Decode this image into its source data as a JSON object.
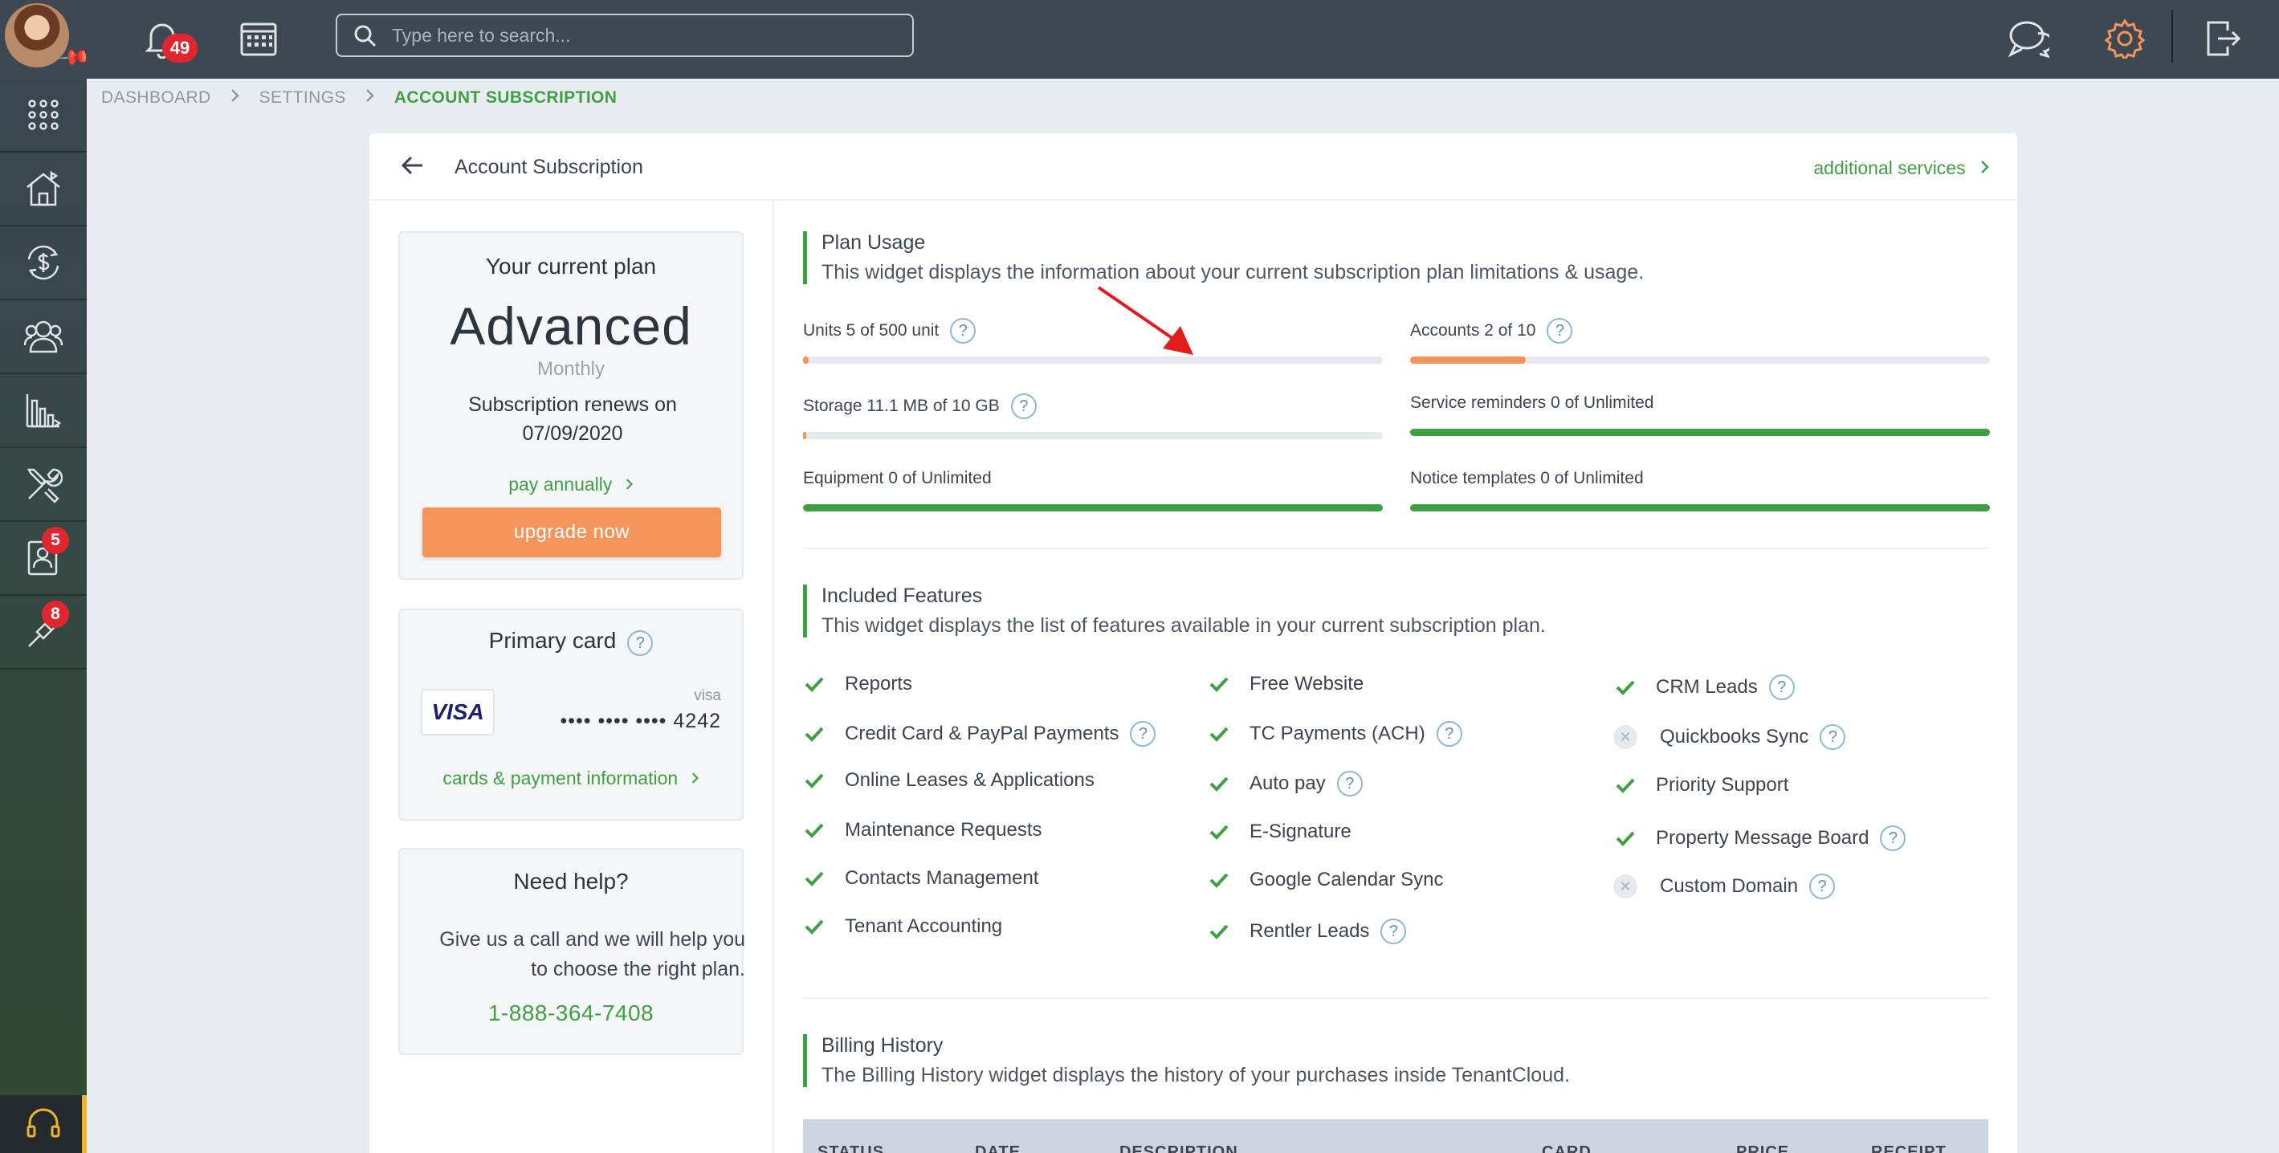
{
  "topbar": {
    "notification_count": "49",
    "search_placeholder": "Type here to search..."
  },
  "sidebar": {
    "items": [
      {
        "icon": "apps-grid-icon"
      },
      {
        "icon": "properties-icon"
      },
      {
        "icon": "accounting-icon"
      },
      {
        "icon": "tenants-icon"
      },
      {
        "icon": "reports-icon"
      },
      {
        "icon": "maintenance-icon"
      },
      {
        "icon": "applications-icon",
        "badge": "5"
      },
      {
        "icon": "tools-icon",
        "badge": "8"
      }
    ]
  },
  "breadcrumb": {
    "items": [
      "DASHBOARD",
      "SETTINGS",
      "ACCOUNT SUBSCRIPTION"
    ]
  },
  "page": {
    "title": "Account Subscription",
    "additional_services": "additional services"
  },
  "plan": {
    "heading": "Your current plan",
    "name": "Advanced",
    "cycle": "Monthly",
    "renew_line1": "Subscription renews on",
    "renew_date": "07/09/2020",
    "pay_annually": "pay annually",
    "upgrade": "upgrade now"
  },
  "primary_card": {
    "heading": "Primary card",
    "brand_logo": "VISA",
    "type": "visa",
    "number": "•••• •••• •••• 4242",
    "link": "cards & payment information"
  },
  "help": {
    "heading": "Need help?",
    "text": "Give us a call and we will help you to choose the right plan.",
    "phone": "1-888-364-7408"
  },
  "plan_usage": {
    "title": "Plan Usage",
    "description": "This widget displays the information about your current subscription plan limitations & usage.",
    "items": [
      {
        "label": "Units 5 of 500 unit",
        "help": true,
        "fill": 0.01,
        "color": "#f4935a"
      },
      {
        "label": "Accounts 2 of 10",
        "help": true,
        "fill": 0.2,
        "color": "#f4935a"
      },
      {
        "label": "Storage 11.1 MB of 10 GB",
        "help": true,
        "fill": 0.001,
        "color": "#f4935a"
      },
      {
        "label": "Service reminders 0 of Unlimited",
        "help": false,
        "fill": 1,
        "color": "#3fa043"
      },
      {
        "label": "Equipment 0 of Unlimited",
        "help": false,
        "fill": 1,
        "color": "#3fa043"
      },
      {
        "label": "Notice templates 0 of Unlimited",
        "help": false,
        "fill": 1,
        "color": "#3fa043"
      }
    ]
  },
  "features": {
    "title": "Included Features",
    "description": "This widget displays the list of features available in your current subscription plan.",
    "col1": [
      {
        "label": "Reports",
        "included": true,
        "help": false
      },
      {
        "label": "Credit Card & PayPal Payments",
        "included": true,
        "help": true
      },
      {
        "label": "Online Leases & Applications",
        "included": true,
        "help": false
      },
      {
        "label": "Maintenance Requests",
        "included": true,
        "help": false
      },
      {
        "label": "Contacts Management",
        "included": true,
        "help": false
      },
      {
        "label": "Tenant Accounting",
        "included": true,
        "help": false
      }
    ],
    "col2": [
      {
        "label": "Free Website",
        "included": true,
        "help": false
      },
      {
        "label": "TC Payments (ACH)",
        "included": true,
        "help": true
      },
      {
        "label": "Auto pay",
        "included": true,
        "help": true
      },
      {
        "label": "E-Signature",
        "included": true,
        "help": false
      },
      {
        "label": "Google Calendar Sync",
        "included": true,
        "help": false
      },
      {
        "label": "Rentler Leads",
        "included": true,
        "help": true
      }
    ],
    "col3": [
      {
        "label": "CRM Leads",
        "included": true,
        "help": true
      },
      {
        "label": "Quickbooks Sync",
        "included": false,
        "help": true
      },
      {
        "label": "Priority Support",
        "included": true,
        "help": false
      },
      {
        "label": "Property Message Board",
        "included": true,
        "help": true
      },
      {
        "label": "Custom Domain",
        "included": false,
        "help": true
      }
    ]
  },
  "billing": {
    "title": "Billing History",
    "description": "The Billing History widget displays the history of your purchases inside TenantCloud.",
    "columns": [
      "STATUS",
      "DATE",
      "DESCRIPTION",
      "CARD",
      "PRICE",
      "RECEIPT"
    ]
  },
  "colors": {
    "accent_green": "#3fa043",
    "accent_orange": "#f4935a",
    "topbar": "#3d4852",
    "badge_red": "#e1262f"
  }
}
